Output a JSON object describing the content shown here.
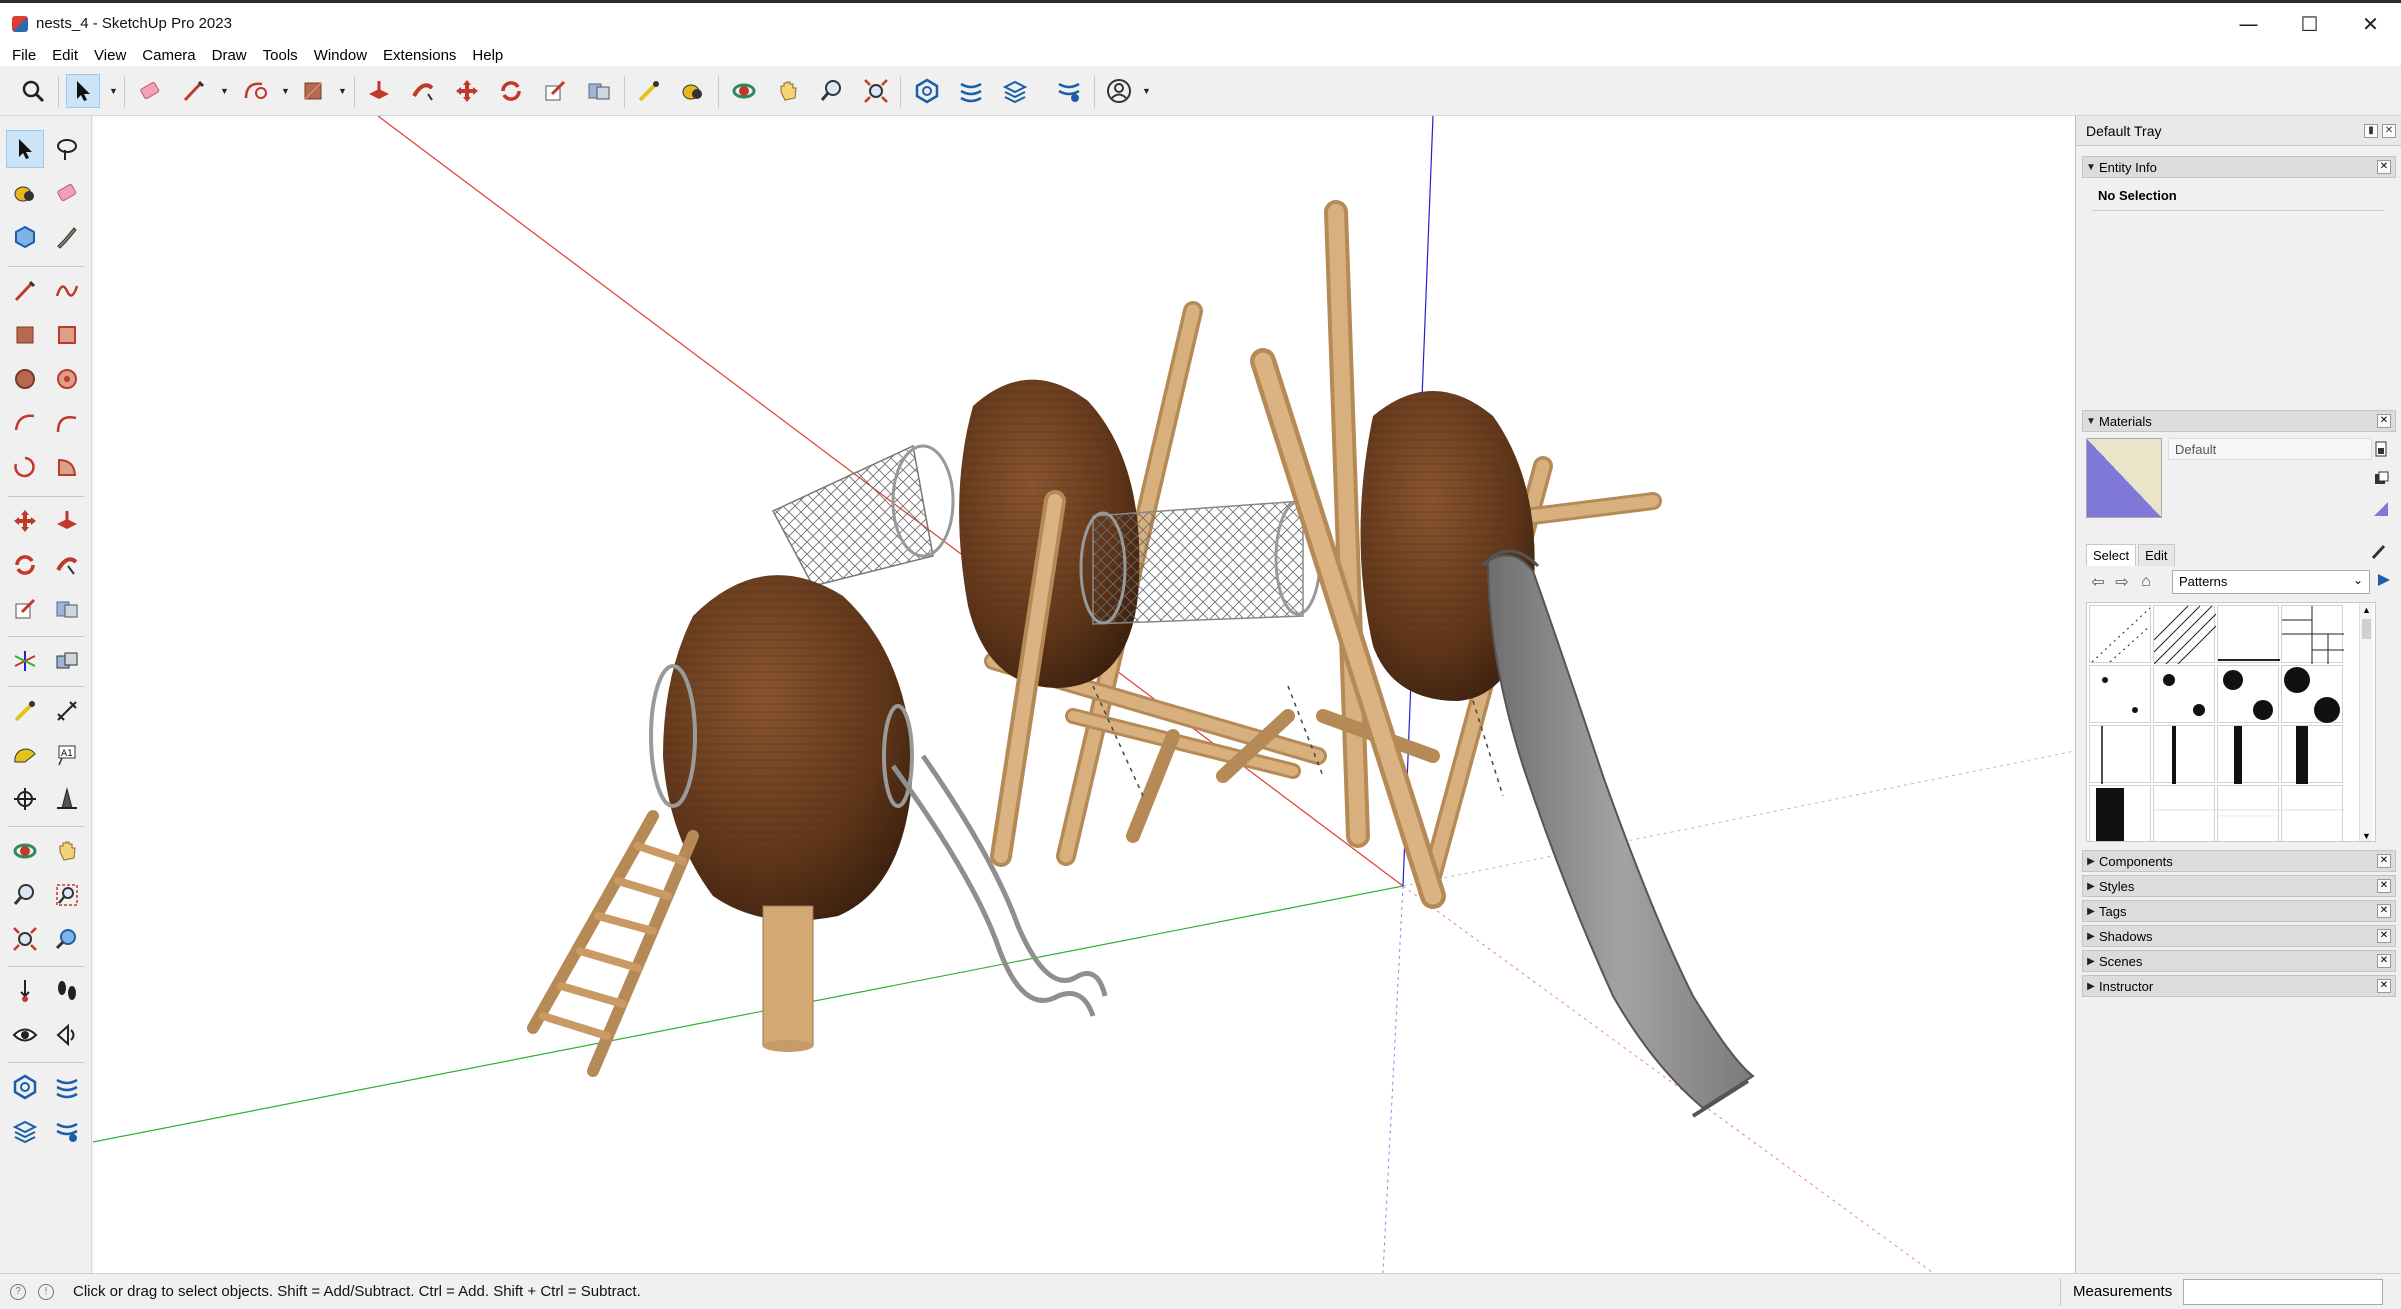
{
  "window": {
    "title": "nests_4 - SketchUp Pro 2023",
    "controls": {
      "minimize": "—",
      "maximize": "☐",
      "close": "✕"
    }
  },
  "menu": [
    "File",
    "Edit",
    "View",
    "Camera",
    "Draw",
    "Tools",
    "Window",
    "Extensions",
    "Help"
  ],
  "toolbar": {
    "tools": [
      "search-icon",
      "select-arrow-icon",
      "eraser-icon",
      "pencil-icon",
      "arc-icon",
      "rectangle-icon",
      "push-pull-icon",
      "follow-me-icon",
      "move-icon",
      "rotate-icon",
      "scale-icon",
      "offset-icon",
      "tape-measure-icon",
      "paint-bucket-icon",
      "orbit-icon",
      "pan-icon",
      "zoom-icon",
      "zoom-extents-icon",
      "warehouse-icon",
      "extension-warehouse-icon",
      "layout-icon",
      "extension-manager-icon",
      "account-icon"
    ]
  },
  "left_toolbar": {
    "tools": [
      "select-icon",
      "lasso-icon",
      "paint-bucket-icon",
      "eraser-icon",
      "make-component-icon",
      "tag-tool-icon",
      "line-icon",
      "freehand-icon",
      "rectangle-icon",
      "rotated-rectangle-icon",
      "circle-icon",
      "polygon-icon",
      "arc-icon",
      "two-point-arc-icon",
      "three-point-arc-icon",
      "pie-icon",
      "move-icon",
      "push-pull-icon",
      "rotate-icon",
      "follow-me-icon",
      "scale-icon",
      "offset-icon",
      "axis-icon",
      "solid-tools-icon",
      "tape-measure-icon",
      "dimension-icon",
      "protractor-icon",
      "text-icon",
      "axes-icon",
      "3d-text-icon",
      "orbit-icon",
      "pan-icon",
      "zoom-icon",
      "zoom-window-icon",
      "zoom-extents-icon",
      "previous-view-icon",
      "position-camera-icon",
      "walk-icon",
      "look-around-icon",
      "section-plane-icon",
      "warehouse-icon",
      "extension-warehouse-icon",
      "layout-icon",
      "extension-manager-icon"
    ]
  },
  "tray": {
    "title": "Default Tray",
    "entity_info": {
      "title": "Entity Info",
      "text": "No Selection"
    },
    "materials": {
      "title": "Materials",
      "material_name": "Default",
      "tabs": [
        "Select",
        "Edit"
      ],
      "collection": "Patterns",
      "swatches": [
        "diagonal-dots",
        "hatch-lines",
        "horizontal-line",
        "brick-grid",
        "dots-small",
        "dots-medium",
        "dots-large",
        "dots-xlarge",
        "line-thin",
        "line-medium",
        "line-thick",
        "line-xthick",
        "block-black",
        "faint-1",
        "faint-2",
        "faint-3"
      ]
    },
    "collapsed_panels": [
      "Components",
      "Styles",
      "Tags",
      "Shadows",
      "Scenes",
      "Instructor"
    ]
  },
  "status": {
    "hint": "Click or drag to select objects. Shift = Add/Subtract. Ctrl = Add. Shift + Ctrl = Subtract.",
    "measurements_label": "Measurements",
    "measurements_value": ""
  },
  "colors": {
    "accent_active": "#cce4f7",
    "axis_red": "#e03c31",
    "axis_green": "#2fb12f",
    "axis_blue": "#2020d0",
    "wood": "#d4aa74",
    "nest_brown": "#6b3f1f",
    "slide_gray": "#8c8c8c"
  }
}
